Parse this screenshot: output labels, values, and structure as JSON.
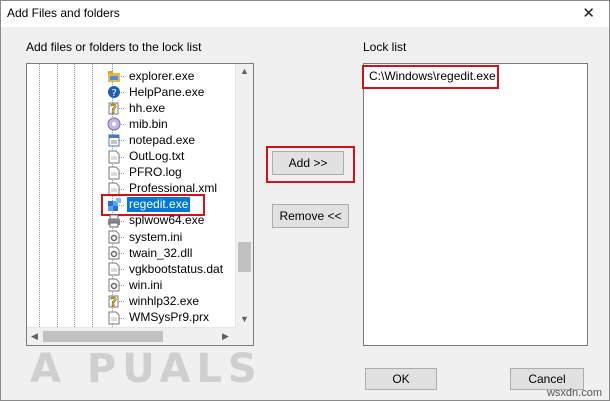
{
  "window": {
    "title": "Add Files and folders"
  },
  "left_label": "Add files or folders to the lock list",
  "right_label": "Lock list",
  "files": [
    {
      "name": "explorer.exe",
      "icon": "folder-app-icon"
    },
    {
      "name": "HelpPane.exe",
      "icon": "help-icon"
    },
    {
      "name": "hh.exe",
      "icon": "help-file-icon"
    },
    {
      "name": "mib.bin",
      "icon": "disc-icon"
    },
    {
      "name": "notepad.exe",
      "icon": "notepad-icon"
    },
    {
      "name": "OutLog.txt",
      "icon": "document-icon"
    },
    {
      "name": "PFRO.log",
      "icon": "document-icon"
    },
    {
      "name": "Professional.xml",
      "icon": "document-icon"
    },
    {
      "name": "regedit.exe",
      "icon": "registry-icon",
      "selected": true
    },
    {
      "name": "splwow64.exe",
      "icon": "printer-icon"
    },
    {
      "name": "system.ini",
      "icon": "settings-file-icon"
    },
    {
      "name": "twain_32.dll",
      "icon": "settings-file-icon"
    },
    {
      "name": "vgkbootstatus.dat",
      "icon": "document-icon"
    },
    {
      "name": "win.ini",
      "icon": "settings-file-icon"
    },
    {
      "name": "winhlp32.exe",
      "icon": "help-file-icon"
    },
    {
      "name": "WMSysPr9.prx",
      "icon": "document-icon"
    }
  ],
  "buttons": {
    "add": "Add >>",
    "remove": "Remove <<",
    "ok": "OK",
    "cancel": "Cancel"
  },
  "lock_list": [
    "C:\\Windows\\regedit.exe"
  ],
  "watermark": "A  PUALS",
  "credit": "wsxdn.com",
  "colors": {
    "selection": "#0078d7",
    "highlight_box": "#d0121b"
  }
}
